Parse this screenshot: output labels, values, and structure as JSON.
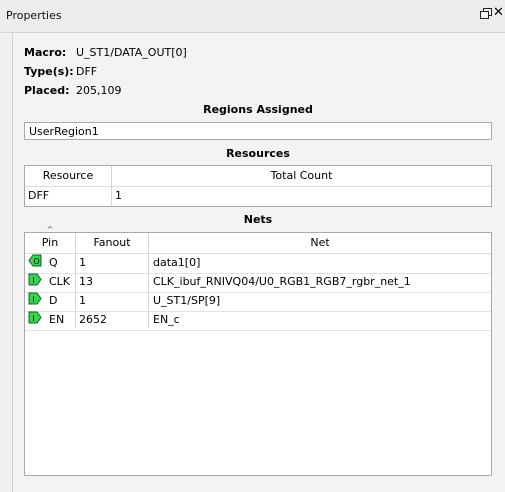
{
  "window": {
    "title": "Properties"
  },
  "properties": {
    "macro_label": "Macro:",
    "macro_value": "U_ST1/DATA_OUT[0]",
    "types_label": "Type(s):",
    "types_value": "DFF",
    "placed_label": "Placed:",
    "placed_value": "205,109"
  },
  "regions": {
    "title": "Regions Assigned",
    "value": "UserRegion1"
  },
  "resources": {
    "title": "Resources",
    "columns": [
      "Resource",
      "Total Count"
    ],
    "rows": [
      [
        "DFF",
        "1"
      ]
    ]
  },
  "nets": {
    "title": "Nets",
    "sort_indicator": "^",
    "columns": [
      "Pin",
      "Fanout",
      "Net"
    ],
    "rows": [
      {
        "pin_icon": "output-pin-icon",
        "pin_glyph": "O",
        "pin": "Q",
        "fanout": "1",
        "net": "data1[0]"
      },
      {
        "pin_icon": "input-pin-icon",
        "pin_glyph": "I",
        "pin": "CLK",
        "fanout": "13",
        "net": "CLK_ibuf_RNIVQ04/U0_RGB1_RGB7_rgbr_net_1"
      },
      {
        "pin_icon": "input-pin-icon",
        "pin_glyph": "I",
        "pin": "D",
        "fanout": "1",
        "net": "U_ST1/SP[9]"
      },
      {
        "pin_icon": "input-pin-icon",
        "pin_glyph": "I",
        "pin": "EN",
        "fanout": "2652",
        "net": "EN_c"
      }
    ]
  },
  "colors": {
    "pin_icon_fill": "#2fd84a",
    "pin_icon_stroke": "#1a5e26"
  }
}
